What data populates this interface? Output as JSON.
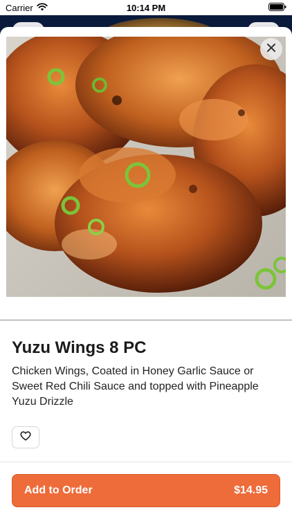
{
  "status_bar": {
    "carrier": "Carrier",
    "time": "10:14 PM",
    "wifi_icon": "wifi-icon",
    "battery_icon": "battery-icon"
  },
  "item": {
    "image": "yuzu-wings-photo",
    "title": "Yuzu Wings 8 PC",
    "description": "Chicken Wings, Coated in Honey Garlic Sauce or Sweet Red Chili Sauce and topped with Pineapple Yuzu Drizzle"
  },
  "actions": {
    "close_icon": "close-icon",
    "favorite_icon": "heart-icon",
    "add_to_order_label": "Add to Order",
    "price": "$14.95"
  },
  "colors": {
    "accent": "#ee6b3a",
    "accent_border": "#d85a2c",
    "text": "#1a1a1a"
  }
}
